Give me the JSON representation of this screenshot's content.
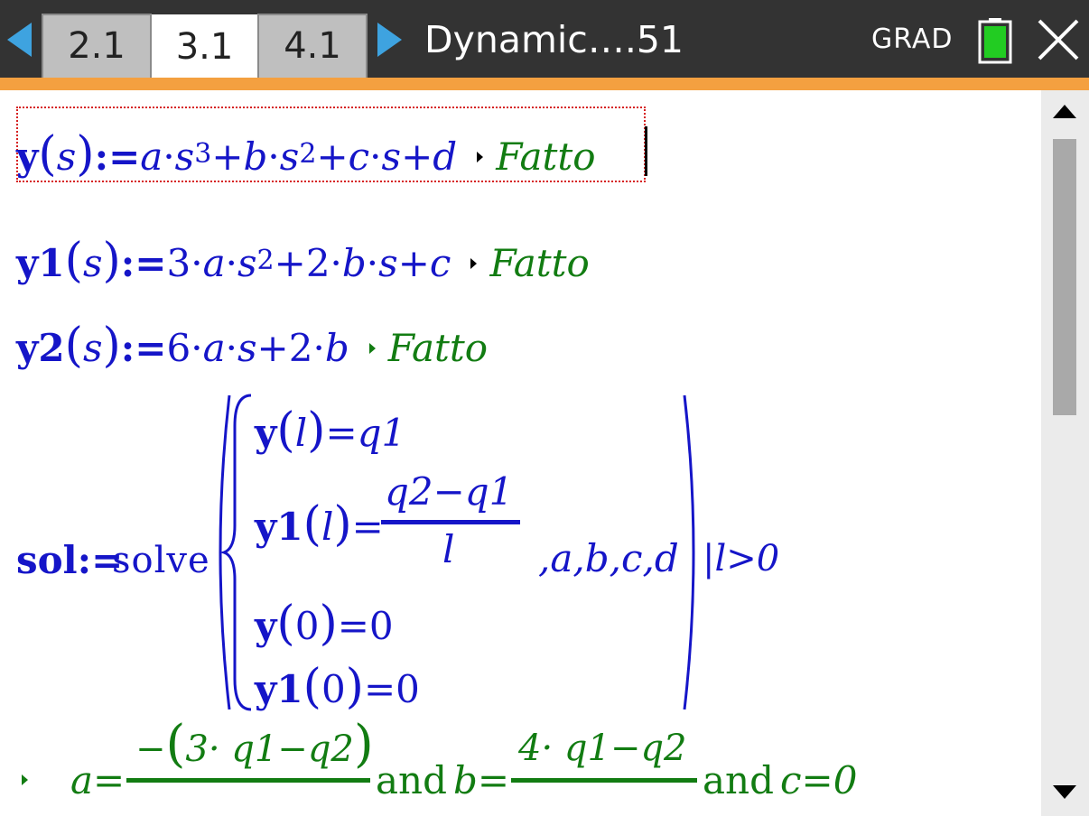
{
  "tabs": [
    {
      "label": "2.1",
      "active": false
    },
    {
      "label": "3.1",
      "active": true
    },
    {
      "label": "4.1",
      "active": false
    }
  ],
  "document_title": "Dynamic….51",
  "angle_mode": "GRAD",
  "icons": {
    "prev": "left-arrow-icon",
    "next": "right-arrow-icon",
    "battery": "battery-icon",
    "close": "close-icon"
  },
  "colors": {
    "input": "#1515c8",
    "result": "#127c12",
    "accent": "#f4a040",
    "tab_arrow": "#3ea3e0",
    "battery": "#22cc22"
  },
  "entries": [
    {
      "name": "y",
      "arg": "s",
      "assign": ":=",
      "expr_parts": [
        "a",
        "·",
        "s",
        "3",
        "+",
        "b",
        "·",
        "s",
        "2",
        "+",
        "c",
        "·",
        "s",
        "+",
        "d"
      ],
      "result": "Fatto",
      "selected": true
    },
    {
      "name": "y1",
      "arg": "s",
      "assign": ":=",
      "expr_parts": [
        "3·",
        "a",
        "·",
        "s",
        "2",
        "+2·",
        "b",
        "·",
        "s",
        "+",
        "c"
      ],
      "result": "Fatto"
    },
    {
      "name": "y2",
      "arg": "s",
      "assign": ":=",
      "expr_parts": [
        "6·",
        "a",
        "·",
        "s",
        "+2·",
        "b"
      ],
      "result": "Fatto"
    }
  ],
  "solve": {
    "name": "sol:=",
    "func": "solve",
    "eq1": {
      "lhs": "y",
      "arg": "l",
      "rhs": "=q1"
    },
    "eq2": {
      "lhs": "y1",
      "arg": "l",
      "eq": "=",
      "num": "q2−q1",
      "den": "l"
    },
    "eq3": {
      "lhs": "y",
      "arg": "0",
      "rhs": "=0"
    },
    "eq4": {
      "lhs": "y1",
      "arg": "0",
      "rhs": "=0"
    },
    "vars": ",a,b,c,d",
    "condition": "|l>0"
  },
  "solution": {
    "a_lhs": "a=",
    "a_num_neg": "−",
    "a_num": "3· q1−q2",
    "and1": "and",
    "b_lhs": "b=",
    "b_num": "4· q1−q2",
    "and2": "and",
    "c": "c=0"
  }
}
